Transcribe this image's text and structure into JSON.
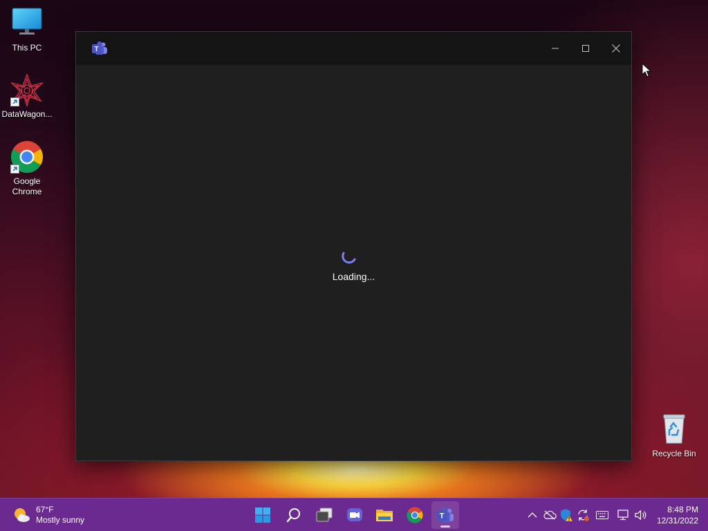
{
  "desktop": {
    "icons": [
      {
        "label": "This PC",
        "icon": "monitor-icon"
      },
      {
        "label": "DataWagon...",
        "icon": "datawagon-icon"
      },
      {
        "label": "Google Chrome",
        "icon": "chrome-icon"
      },
      {
        "label": "Recycle Bin",
        "icon": "recycle-bin-icon"
      }
    ]
  },
  "window": {
    "app_icon": "teams-icon",
    "app_icon_letter": "T",
    "controls": [
      "minimize-icon",
      "maximize-icon",
      "close-icon"
    ],
    "loading_text": "Loading...",
    "spinner_color": "#7b83eb"
  },
  "taskbar": {
    "weather": {
      "temperature": "67°F",
      "condition": "Mostly sunny",
      "icon": "partly-sunny-icon"
    },
    "pinned": [
      {
        "name": "start",
        "icon": "windows-start-icon"
      },
      {
        "name": "search",
        "icon": "search-icon"
      },
      {
        "name": "task-view",
        "icon": "task-view-icon"
      },
      {
        "name": "chat",
        "icon": "chat-icon"
      },
      {
        "name": "file-explorer",
        "icon": "folder-icon"
      },
      {
        "name": "chrome",
        "icon": "chrome-icon"
      },
      {
        "name": "teams",
        "icon": "teams-icon",
        "active": true
      }
    ],
    "tray": [
      "chevron-up-icon",
      "onedrive-offline-icon",
      "defender-warning-icon",
      "sync-icon",
      "keyboard-icon",
      "network-icon",
      "volume-icon"
    ],
    "clock": {
      "time": "8:48 PM",
      "date": "12/31/2022"
    },
    "color": "#6b2a8f"
  }
}
